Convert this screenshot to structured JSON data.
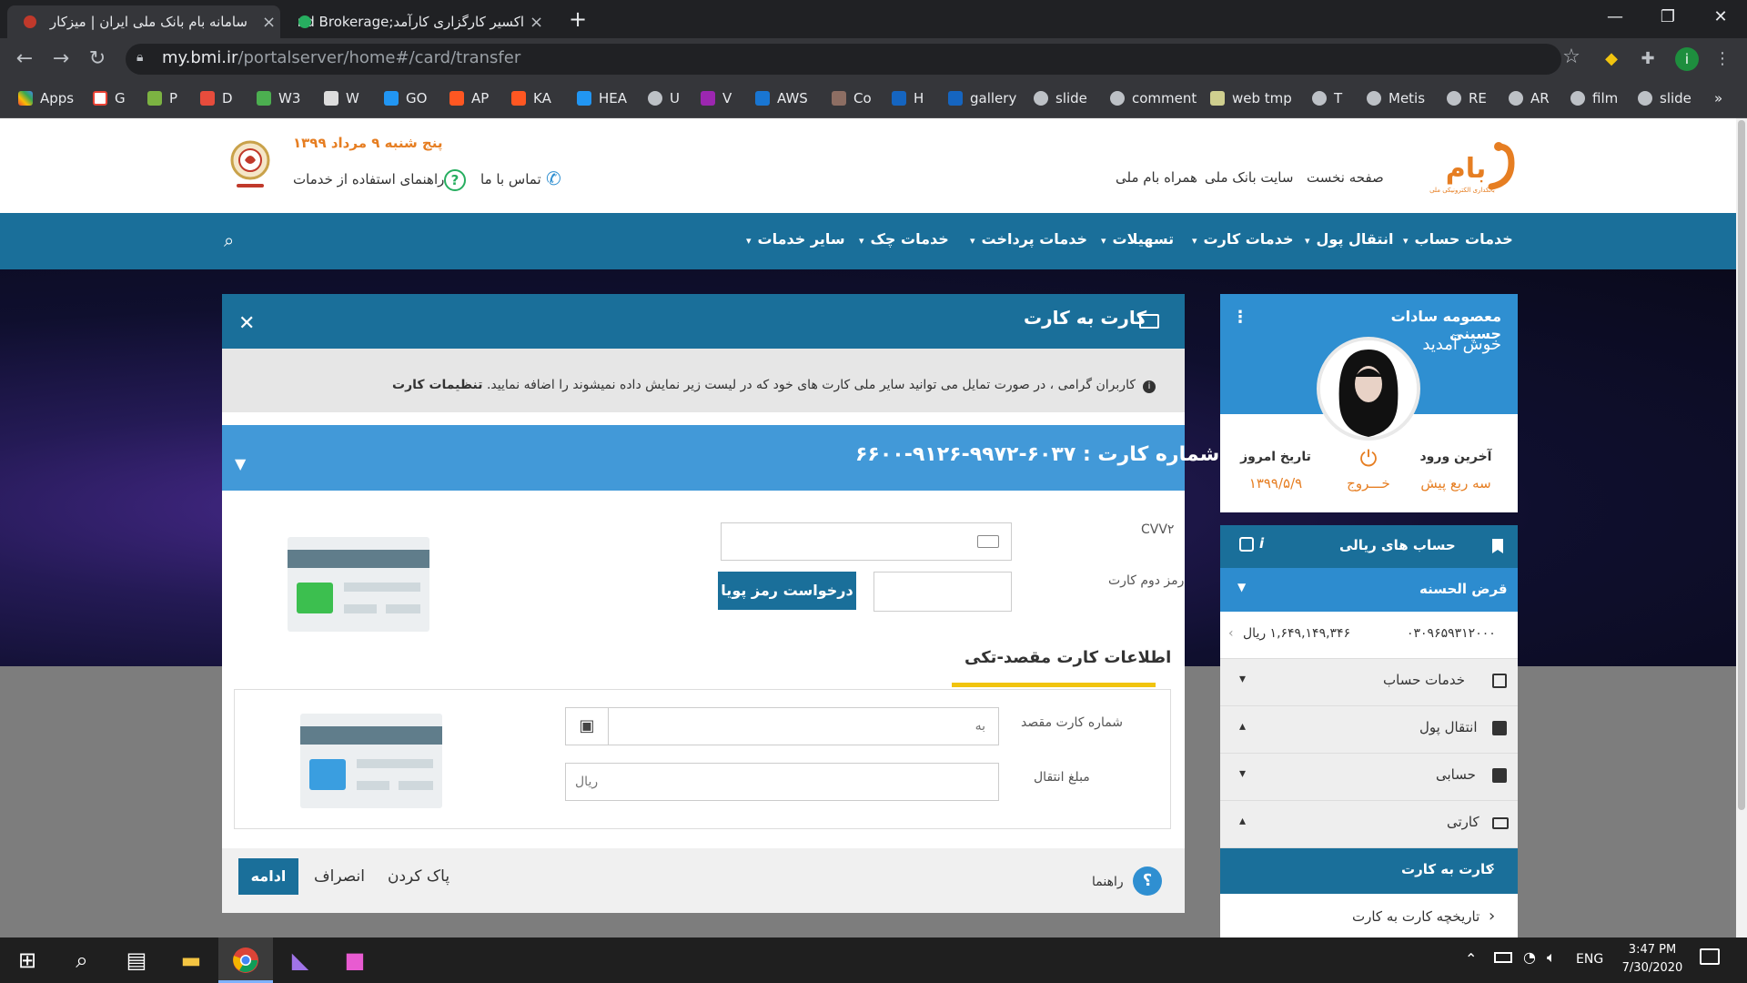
{
  "browser": {
    "tabs": [
      {
        "title": "سامانه بام بانک ملی ایران | میزکار",
        "active": true
      },
      {
        "title": "اکسیر کارگزاری کارآمد;nd Brokerage",
        "active": false
      }
    ],
    "url_host": "my.bmi.ir",
    "url_path": "/portalserver/home#/card/transfer",
    "profile_initial": "i",
    "bookmarks": [
      "Apps",
      "G",
      "P",
      "D",
      "W3",
      "W",
      "GO",
      "AP",
      "KA",
      "HEA",
      "U",
      "V",
      "AWS",
      "Co",
      "H",
      "gallery",
      "slide",
      "comment",
      "web tmp",
      "T",
      "Metis",
      "RE",
      "AR",
      "film",
      "slide"
    ]
  },
  "site": {
    "logo_text": "بام",
    "logo_sub": "بانکداری الکترونیکی ملی",
    "header_links": [
      "صفحه نخست",
      "سایت بانک ملی",
      "همراه بام ملی"
    ],
    "date": "پنج شنبه ۹ مرداد ۱۳۹۹",
    "contact": "تماس با ما",
    "guide": "راهنمای استفاده از خدمات",
    "menu": [
      "خدمات حساب",
      "انتقال پول",
      "خدمات کارت",
      "تسهیلات",
      "خدمات پرداخت",
      "خدمات چک",
      "سایر خدمات"
    ]
  },
  "transfer": {
    "title": "کارت به کارت",
    "info_text": "کاربران گرامی ، در صورت تمایل می توانید سایر ملی کارت های خود که در لیست زیر نمایش داده نمیشوند را اضافه نمایید.",
    "info_link": "تنظیمات کارت",
    "card_label": "شماره کارت :",
    "card_number": "۶۰۳۷-۹۹۷۲-۹۱۲۶-۶۶۰۰",
    "cvv2_label": "CVV۲",
    "pin2_label": "رمز دوم کارت",
    "pooya_button": "درخواست رمز پویا",
    "dest_title": "اطلاعات کارت مقصد-تکی",
    "dest_card_label": "شماره کارت مقصد",
    "dest_card_placeholder": "به",
    "amount_label": "مبلغ انتقال",
    "amount_placeholder": "ریال",
    "guide_label": "راهنما",
    "clear_button": "پاک کردن",
    "cancel_button": "انصراف",
    "continue_button": "ادامه"
  },
  "profile": {
    "name": "معصومه سادات حسینی",
    "welcome": "خوش آمدید",
    "last_login_label": "آخرین ورود",
    "last_login_value": "سه ربع پیش",
    "logout": "خـــروج",
    "today_label": "تاریخ امروز",
    "today_value": "۱۳۹۹/۵/۹"
  },
  "accounts": {
    "header": "حساب های ریالی",
    "sub": "قرض الحسنه",
    "account_no": "۰۳۰۹۶۵۹۳۱۲۰۰۰",
    "balance": "۱,۶۴۹,۱۴۹,۳۴۶ ریال",
    "items": [
      {
        "label": "خدمات حساب",
        "caret": "▾"
      },
      {
        "label": "انتقال پول",
        "caret": "▴"
      },
      {
        "label": "حسابی",
        "caret": "▾"
      },
      {
        "label": "کارتی",
        "caret": "▴"
      }
    ],
    "active_item": "کارت به کارت",
    "history_item": "تاریخچه کارت به کارت"
  },
  "taskbar": {
    "lang": "ENG",
    "time": "3:47 PM",
    "date": "7/30/2020"
  }
}
